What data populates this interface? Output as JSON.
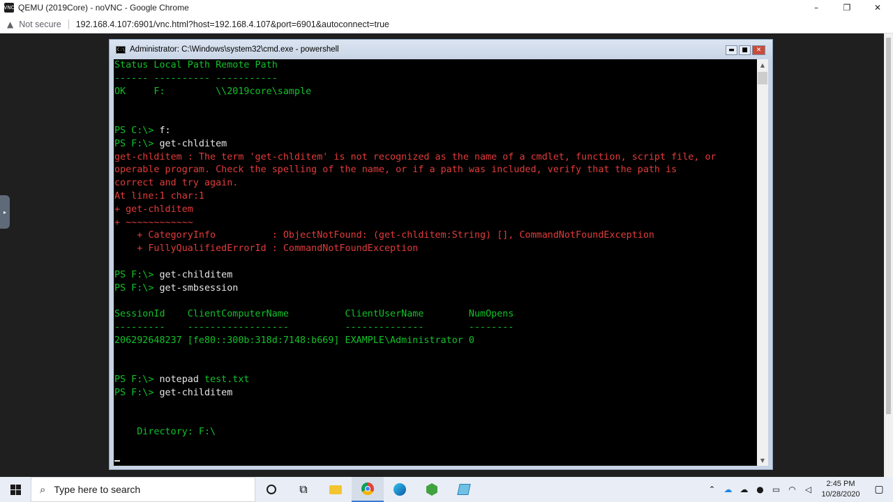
{
  "browser": {
    "title": "QEMU (2019Core) - noVNC - Google Chrome",
    "security_label": "Not secure",
    "url": "192.168.4.107:6901/vnc.html?host=192.168.4.107&port=6901&autoconnect=true",
    "controls": {
      "minimize": "–",
      "maximize": "❐",
      "close": "✕"
    }
  },
  "cmd_window": {
    "title": "Administrator: C:\\Windows\\system32\\cmd.exe - powershell",
    "controls": {
      "minimize": "▬",
      "maximize": "■",
      "close": "✕"
    }
  },
  "console_lines": [
    {
      "text": "Status Local Path Remote Path",
      "color": "g"
    },
    {
      "text": "------ ---------- -----------",
      "color": "g"
    },
    {
      "text": "OK     F:         \\\\2019core\\sample",
      "color": "g"
    },
    {
      "text": "",
      "color": "g"
    },
    {
      "text": "",
      "color": "g"
    },
    {
      "segments": [
        {
          "text": "PS C:\\> ",
          "color": "g"
        },
        {
          "text": "f:",
          "color": "w"
        }
      ]
    },
    {
      "segments": [
        {
          "text": "PS F:\\> ",
          "color": "g"
        },
        {
          "text": "get-chlditem",
          "color": "w"
        }
      ]
    },
    {
      "text": "get-chlditem : The term 'get-chlditem' is not recognized as the name of a cmdlet, function, script file, or",
      "color": "r"
    },
    {
      "text": "operable program. Check the spelling of the name, or if a path was included, verify that the path is",
      "color": "r"
    },
    {
      "text": "correct and try again.",
      "color": "r"
    },
    {
      "text": "At line:1 char:1",
      "color": "r"
    },
    {
      "text": "+ get-chlditem",
      "color": "r"
    },
    {
      "text": "+ ~~~~~~~~~~~~",
      "color": "r"
    },
    {
      "text": "    + CategoryInfo          : ObjectNotFound: (get-chlditem:String) [], CommandNotFoundException",
      "color": "r"
    },
    {
      "text": "    + FullyQualifiedErrorId : CommandNotFoundException",
      "color": "r"
    },
    {
      "text": "",
      "color": "g"
    },
    {
      "segments": [
        {
          "text": "PS F:\\> ",
          "color": "g"
        },
        {
          "text": "get-childitem",
          "color": "w"
        }
      ]
    },
    {
      "segments": [
        {
          "text": "PS F:\\> ",
          "color": "g"
        },
        {
          "text": "get-smbsession",
          "color": "w"
        }
      ]
    },
    {
      "text": "",
      "color": "g"
    },
    {
      "text": "SessionId    ClientComputerName          ClientUserName        NumOpens",
      "color": "g"
    },
    {
      "text": "---------    ------------------          --------------        --------",
      "color": "g"
    },
    {
      "text": "206292648237 [fe80::300b:318d:7148:b669] EXAMPLE\\Administrator 0",
      "color": "g"
    },
    {
      "text": "",
      "color": "g"
    },
    {
      "text": "",
      "color": "g"
    },
    {
      "segments": [
        {
          "text": "PS F:\\> ",
          "color": "g"
        },
        {
          "text": "notepad ",
          "color": "w"
        },
        {
          "text": "test.txt",
          "color": "g"
        }
      ]
    },
    {
      "segments": [
        {
          "text": "PS F:\\> ",
          "color": "g"
        },
        {
          "text": "get-childitem",
          "color": "w"
        }
      ]
    },
    {
      "text": "",
      "color": "g"
    },
    {
      "text": "",
      "color": "g"
    },
    {
      "text": "    Directory: F:\\",
      "color": "g"
    }
  ],
  "taskbar": {
    "search_placeholder": "Type here to search",
    "clock_time": "2:45 PM",
    "clock_date": "10/28/2020",
    "pinned": [
      "cortana-icon",
      "task-view-icon",
      "file-explorer-icon",
      "chrome-icon",
      "edge-icon",
      "server-app-icon",
      "notes-app-icon"
    ],
    "tray_icons": [
      "chevron-up-icon",
      "onedrive-icon",
      "cloud-icon",
      "microphone-icon",
      "network-icon",
      "wifi-icon",
      "speaker-icon"
    ]
  },
  "colors": {
    "console_bg": "#000000",
    "console_green": "#12c12a",
    "console_red": "#e23b3b",
    "console_white": "#e6e6e6"
  }
}
